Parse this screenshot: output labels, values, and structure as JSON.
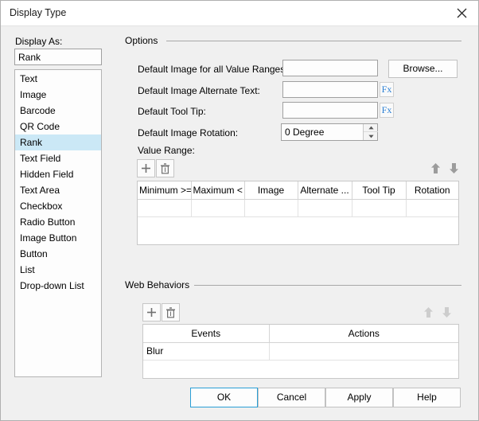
{
  "window": {
    "title": "Display Type",
    "close_icon": "close-icon"
  },
  "left_pane": {
    "label": "Display As:",
    "selected_value": "Rank",
    "items": [
      "Text",
      "Image",
      "Barcode",
      "QR Code",
      "Rank",
      "Text Field",
      "Hidden Field",
      "Text Area",
      "Checkbox",
      "Radio Button",
      "Image Button",
      "Button",
      "List",
      "Drop-down List"
    ],
    "selected_index": 4
  },
  "options": {
    "legend": "Options",
    "default_image_label": "Default Image for all Value Ranges:",
    "default_image_value": "",
    "browse_label": "Browse...",
    "alt_text_label": "Default Image Alternate Text:",
    "alt_text_value": "",
    "alt_text_fx": "Fx",
    "tooltip_label": "Default Tool Tip:",
    "tooltip_value": "",
    "tooltip_fx": "Fx",
    "rotation_label": "Default Image Rotation:",
    "rotation_value": "0 Degree",
    "value_range_label": "Value Range:",
    "toolbar": {
      "add_icon": "plus-icon",
      "delete_icon": "trash-icon",
      "move_up_icon": "arrow-up-icon",
      "move_down_icon": "arrow-down-icon"
    },
    "table": {
      "columns": [
        "Minimum >=",
        "Maximum <",
        "Image",
        "Alternate ...",
        "Tool Tip",
        "Rotation"
      ],
      "rows": [
        [
          "",
          "",
          "",
          "",
          "",
          ""
        ]
      ]
    }
  },
  "web_behaviors": {
    "legend": "Web Behaviors",
    "toolbar": {
      "add_icon": "plus-icon",
      "delete_icon": "trash-icon",
      "move_up_icon": "arrow-up-icon",
      "move_down_icon": "arrow-down-icon"
    },
    "table": {
      "columns": [
        "Events",
        "Actions"
      ],
      "rows": [
        [
          "Blur",
          ""
        ]
      ]
    }
  },
  "footer": {
    "ok_label": "OK",
    "cancel_label": "Cancel",
    "apply_label": "Apply",
    "help_label": "Help"
  },
  "colors": {
    "dialog_background": "#f0f0f0",
    "titlebar_background": "#ffffff",
    "selection_blue": "#cbe8f6",
    "accent_blue": "#2a9fd6",
    "fx_blue": "#2a7fd4",
    "icon_gray": "#808080",
    "icon_gray_disabled": "#c8c8c8"
  }
}
